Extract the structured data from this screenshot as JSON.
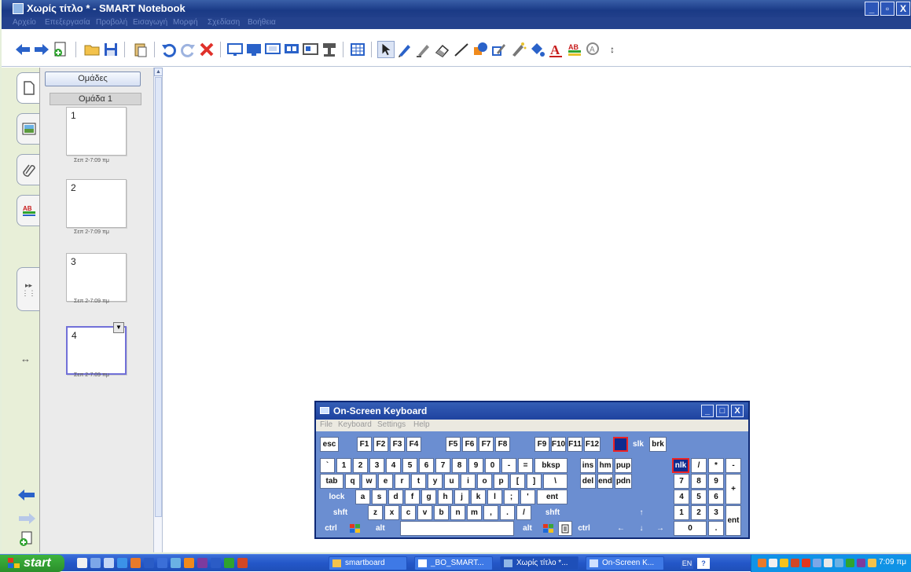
{
  "window": {
    "title": "Χωρίς τίτλο * - SMART Notebook",
    "controls": [
      "_",
      "▫",
      "X"
    ]
  },
  "menu": [
    "Αρχείο",
    "Επεξεργασία",
    "Προβολή",
    "Εισαγωγή",
    "Μορφή",
    "Σχεδίαση",
    "Βοήθεια"
  ],
  "toolbar_icons": [
    "back-arrow-icon",
    "forward-arrow-icon",
    "add-page-icon",
    "open-folder-icon",
    "save-icon",
    "paste-icon",
    "undo-icon",
    "redo-icon",
    "delete-icon",
    "screen-shade-icon",
    "full-screen-icon",
    "transparent-background-icon",
    "dual-page-icon",
    "screen-capture-icon",
    "document-camera-icon",
    "table-icon",
    "select-icon",
    "pen-icon",
    "creative-pen-icon",
    "eraser-icon",
    "line-icon",
    "shape-icon",
    "shape-recognition-pen-icon",
    "magic-pen-icon",
    "fill-icon",
    "text-icon",
    "properties-icon",
    "more-tools-icon",
    "move-toolbar-icon"
  ],
  "sorter": {
    "groups_button": "Ομάδες",
    "group_label": "Ομάδα 1",
    "pages": [
      {
        "num": "1",
        "label": "Σεπ 2-7:09 πμ"
      },
      {
        "num": "2",
        "label": "Σεπ 2-7:09 πμ"
      },
      {
        "num": "3",
        "label": "Σεπ 2-7:09 πμ"
      },
      {
        "num": "4",
        "label": "Σεπ 2-7:09 πμ"
      }
    ]
  },
  "osk": {
    "title": "On-Screen Keyboard",
    "menu": [
      "File",
      "Keyboard",
      "Settings",
      "Help"
    ],
    "row0": [
      "esc",
      "F1",
      "F2",
      "F3",
      "F4",
      "F5",
      "F6",
      "F7",
      "F8",
      "F9",
      "F10",
      "F11",
      "F12",
      "slk",
      "brk"
    ],
    "row1": [
      "`",
      "1",
      "2",
      "3",
      "4",
      "5",
      "6",
      "7",
      "8",
      "9",
      "0",
      "-",
      "=",
      "bksp",
      "ins",
      "hm",
      "pup",
      "nlk",
      "/",
      "*",
      "-"
    ],
    "row2": [
      "tab",
      "q",
      "w",
      "e",
      "r",
      "t",
      "y",
      "u",
      "i",
      "o",
      "p",
      "[",
      "]",
      "\\",
      "del",
      "end",
      "pdn",
      "7",
      "8",
      "9",
      "+"
    ],
    "row3": [
      "lock",
      "a",
      "s",
      "d",
      "f",
      "g",
      "h",
      "j",
      "k",
      "l",
      ";",
      "'",
      "ent",
      "4",
      "5",
      "6"
    ],
    "row4": [
      "shft",
      "z",
      "x",
      "c",
      "v",
      "b",
      "n",
      "m",
      ",",
      ".",
      "/",
      "shft",
      "↑",
      "1",
      "2",
      "3",
      "ent"
    ],
    "row5": [
      "ctrl",
      "alt",
      "alt",
      "ctrl",
      "←",
      "↓",
      "→",
      "0",
      "."
    ]
  },
  "taskbar": {
    "start": "start",
    "tasks": [
      "smartboard",
      "_BO_SMART...",
      "Χωρίς τίτλο *...",
      "On-Screen K..."
    ],
    "lang": "EN",
    "time": "7:09 πμ"
  }
}
